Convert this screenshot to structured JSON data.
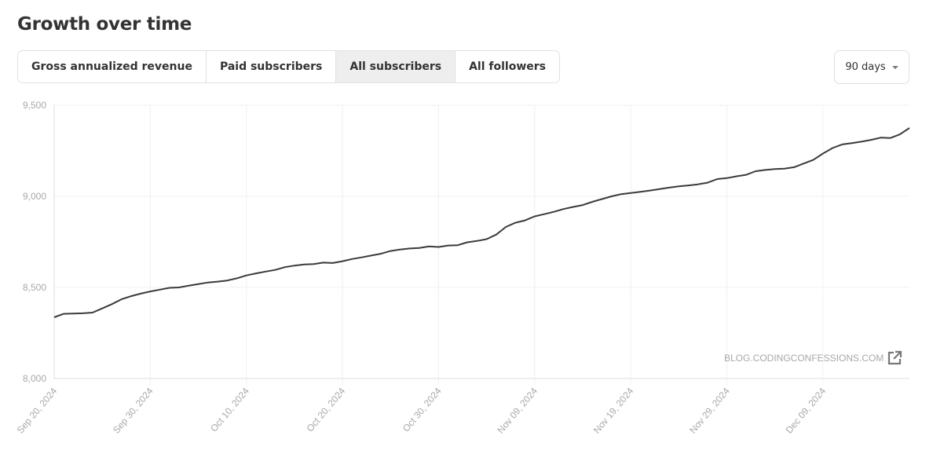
{
  "header": {
    "title": "Growth over time"
  },
  "tabs": [
    {
      "label": "Gross annualized revenue",
      "active": false
    },
    {
      "label": "Paid subscribers",
      "active": false
    },
    {
      "label": "All subscribers",
      "active": true
    },
    {
      "label": "All followers",
      "active": false
    }
  ],
  "range_select": {
    "value": "90 days"
  },
  "watermark": {
    "text": "BLOG.CODINGCONFESSIONS.COM",
    "icon": "external-link-icon"
  },
  "chart_data": {
    "type": "line",
    "title": "",
    "xlabel": "",
    "ylabel": "",
    "series_name": "All subscribers",
    "line_color": "#3a3a3a",
    "grid": true,
    "ylim": [
      8000,
      9500
    ],
    "yticks": [
      8000,
      8500,
      9000,
      9500
    ],
    "ytick_labels": [
      "8,000",
      "8,500",
      "9,000",
      "9,500"
    ],
    "x_start": "2024-09-20",
    "x_days": 90,
    "xtick_day_offsets": [
      0,
      10,
      20,
      30,
      40,
      50,
      60,
      70,
      80
    ],
    "xtick_labels": [
      "Sep 20, 2024",
      "Sep 30, 2024",
      "Oct 10, 2024",
      "Oct 20, 2024",
      "Oct 30, 2024",
      "Nov 09, 2024",
      "Nov 19, 2024",
      "Nov 29, 2024",
      "Dec 09, 2024"
    ],
    "values": [
      8336,
      8355,
      8357,
      8358,
      8362,
      8385,
      8408,
      8435,
      8452,
      8466,
      8478,
      8488,
      8498,
      8500,
      8510,
      8518,
      8527,
      8532,
      8538,
      8550,
      8566,
      8577,
      8587,
      8596,
      8611,
      8620,
      8626,
      8628,
      8636,
      8634,
      8644,
      8656,
      8665,
      8675,
      8685,
      8700,
      8708,
      8714,
      8717,
      8725,
      8722,
      8730,
      8732,
      8748,
      8755,
      8765,
      8790,
      8832,
      8855,
      8868,
      8890,
      8902,
      8915,
      8930,
      8942,
      8952,
      8970,
      8985,
      9000,
      9012,
      9018,
      9025,
      9032,
      9040,
      9048,
      9055,
      9060,
      9066,
      9075,
      9095,
      9100,
      9110,
      9118,
      9138,
      9145,
      9150,
      9152,
      9160,
      9180,
      9200,
      9235,
      9265,
      9285,
      9292,
      9300,
      9310,
      9322,
      9320,
      9340,
      9375
    ]
  }
}
